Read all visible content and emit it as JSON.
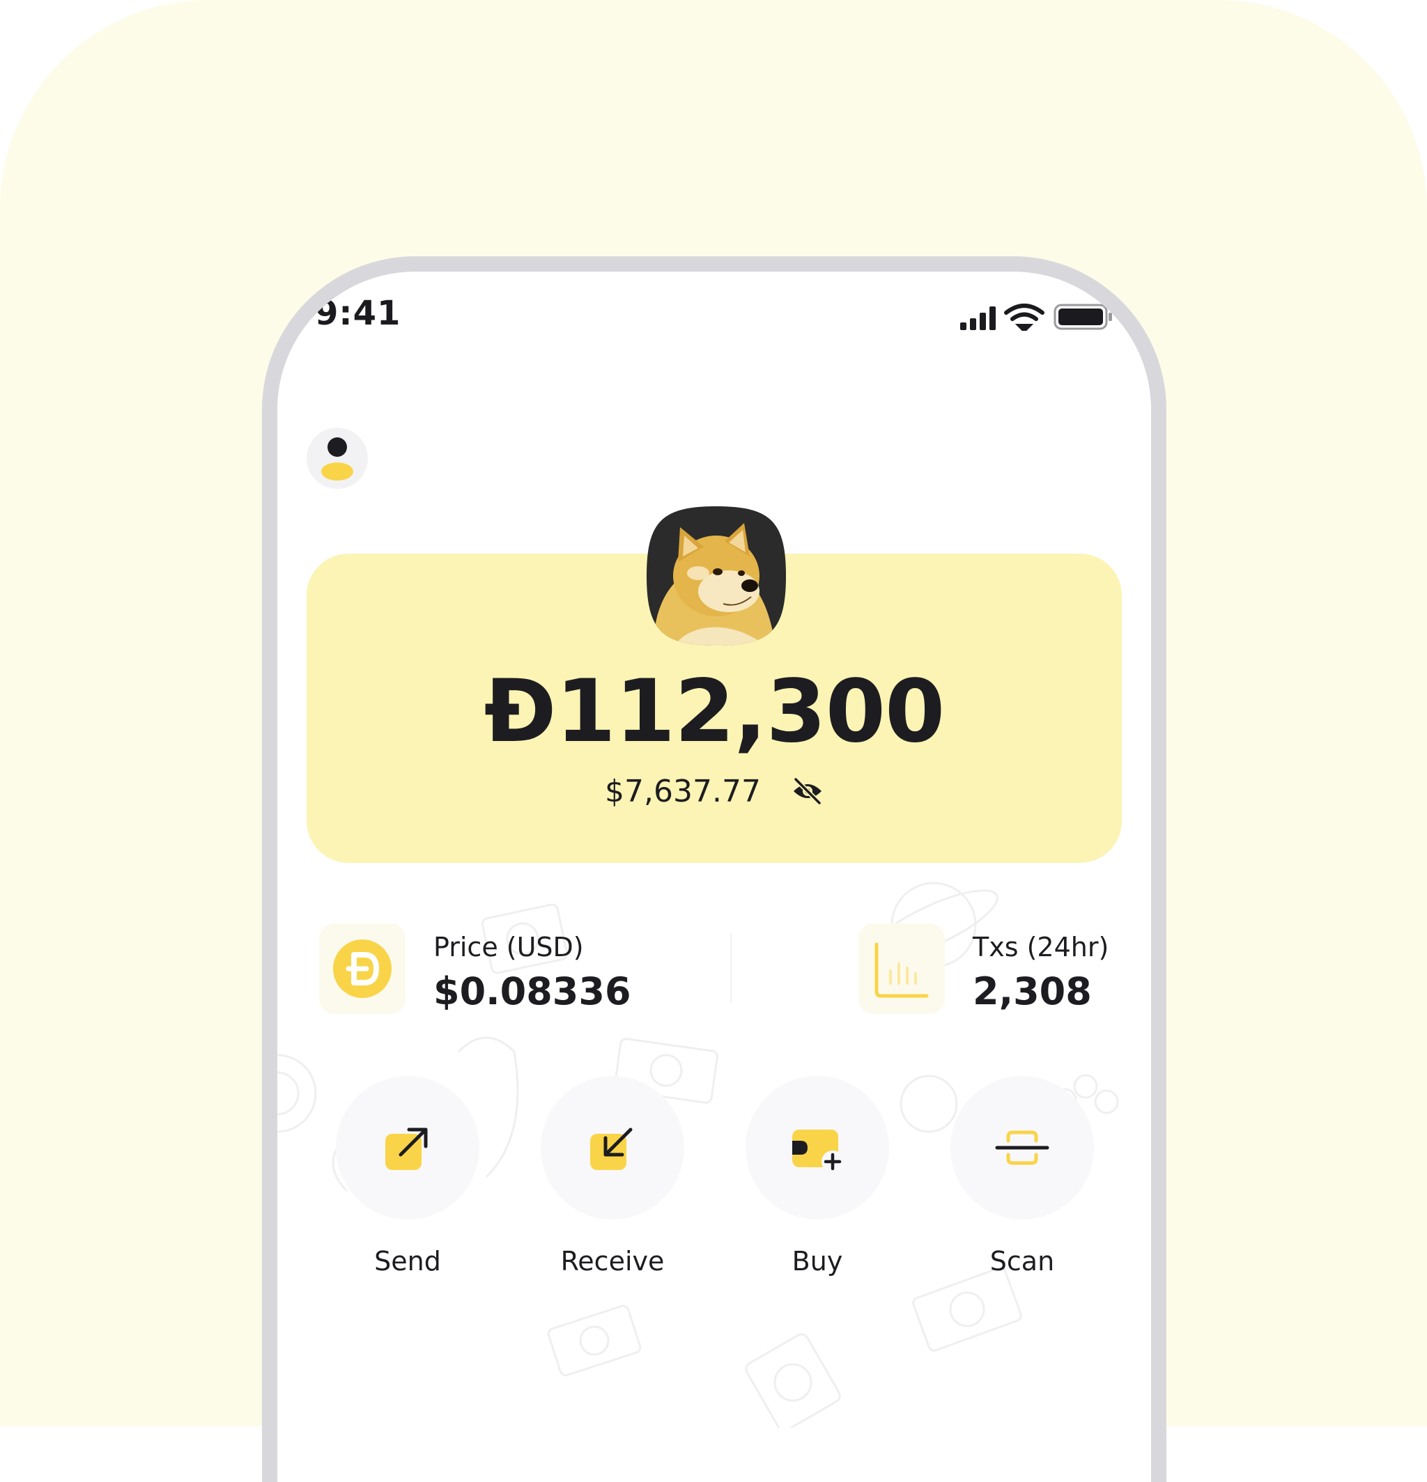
{
  "status_bar": {
    "time": "9:41"
  },
  "balance": {
    "amount": "Đ112,300",
    "fiat": "$7,637.77"
  },
  "stats": {
    "price": {
      "label": "Price (USD)",
      "value": "$0.08336",
      "icon": "doge-coin-icon"
    },
    "txs": {
      "label": "Txs (24hr)",
      "value": "2,308",
      "icon": "bar-chart-icon"
    }
  },
  "actions": [
    {
      "label": "Send",
      "icon": "send-arrow-icon"
    },
    {
      "label": "Receive",
      "icon": "receive-arrow-icon"
    },
    {
      "label": "Buy",
      "icon": "buy-wallet-icon"
    },
    {
      "label": "Scan",
      "icon": "scan-icon"
    }
  ],
  "colors": {
    "accent_yellow": "#F9D448",
    "card_yellow": "#FCF4B4",
    "background_tint": "#FDFCE8",
    "text_dark": "#1D1D21"
  }
}
